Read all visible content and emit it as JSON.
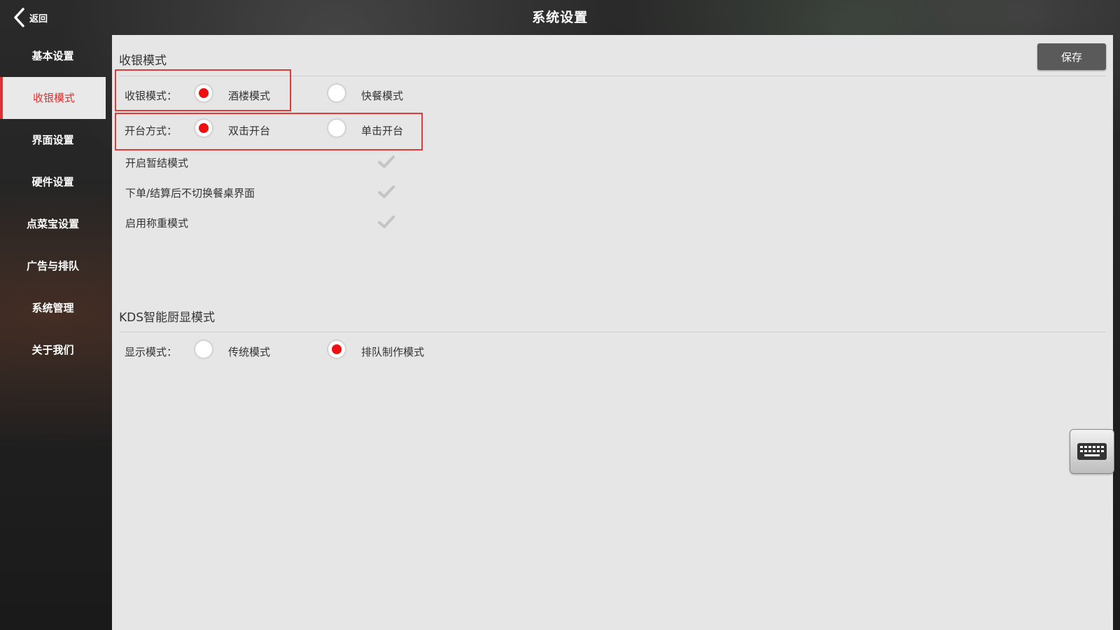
{
  "header": {
    "back_label": "返回",
    "title": "系统设置"
  },
  "sidebar": {
    "items": [
      {
        "label": "基本设置"
      },
      {
        "label": "收银模式",
        "active": true
      },
      {
        "label": "界面设置"
      },
      {
        "label": "硬件设置"
      },
      {
        "label": "点菜宝设置"
      },
      {
        "label": "广告与排队"
      },
      {
        "label": "系统管理"
      },
      {
        "label": "关于我们"
      }
    ]
  },
  "cashier_section": {
    "title": "收银模式",
    "save_label": "保存",
    "cashier_mode": {
      "label": "收银模式：",
      "options": [
        {
          "label": "酒楼模式",
          "selected": true
        },
        {
          "label": "快餐模式",
          "selected": false
        }
      ]
    },
    "open_table": {
      "label": "开台方式：",
      "options": [
        {
          "label": "双击开台",
          "selected": true
        },
        {
          "label": "单击开台",
          "selected": false
        }
      ]
    },
    "toggles": [
      {
        "label": "开启暂结模式",
        "checked": false
      },
      {
        "label": "下单/结算后不切换餐桌界面",
        "checked": false
      },
      {
        "label": "启用称重模式",
        "checked": false
      }
    ]
  },
  "kds_section": {
    "title": "KDS智能厨显模式",
    "display_mode": {
      "label": "显示模式：",
      "options": [
        {
          "label": "传统模式",
          "selected": false
        },
        {
          "label": "排队制作模式",
          "selected": true
        }
      ]
    }
  },
  "colors": {
    "accent": "#e03030",
    "radio_on": "#ee1010",
    "panel_bg": "#e6e6e6",
    "save_bg": "#5a5a5a"
  },
  "icons": {
    "back": "chevron-left-icon",
    "keyboard": "keyboard-icon",
    "check": "check-icon"
  }
}
